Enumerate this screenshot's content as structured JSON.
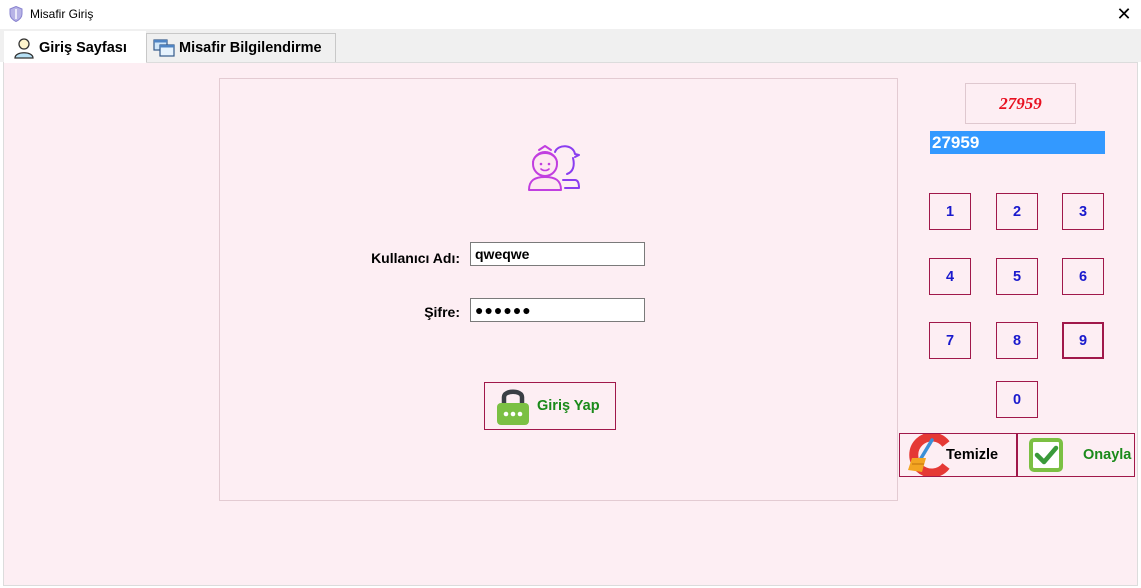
{
  "window": {
    "title": "Misafir Giriş",
    "close_glyph": "✕"
  },
  "tabs": [
    {
      "label": "Giriş Sayfası",
      "icon": "user-icon",
      "active": true
    },
    {
      "label": "Misafir Bilgilendirme",
      "icon": "windows-icon",
      "active": false
    }
  ],
  "login": {
    "username_label": "Kullanıcı Adı:",
    "username_value": "qweqwe",
    "password_label": "Şifre:",
    "password_value": "●●●●●●",
    "submit_label": "Giriş Yap"
  },
  "captcha": {
    "code": "27959",
    "entered": "27959"
  },
  "keypad": [
    "1",
    "2",
    "3",
    "4",
    "5",
    "6",
    "7",
    "8",
    "9",
    "0"
  ],
  "actions": {
    "clear_label": "Temizle",
    "confirm_label": "Onayla"
  },
  "colors": {
    "accent_border": "#a0184a",
    "captcha_red": "#e81020",
    "key_blue": "#1a1acd",
    "ok_green": "#1a8a1a",
    "panel_bg": "#fdeef3",
    "selection_blue": "#3399ff"
  }
}
